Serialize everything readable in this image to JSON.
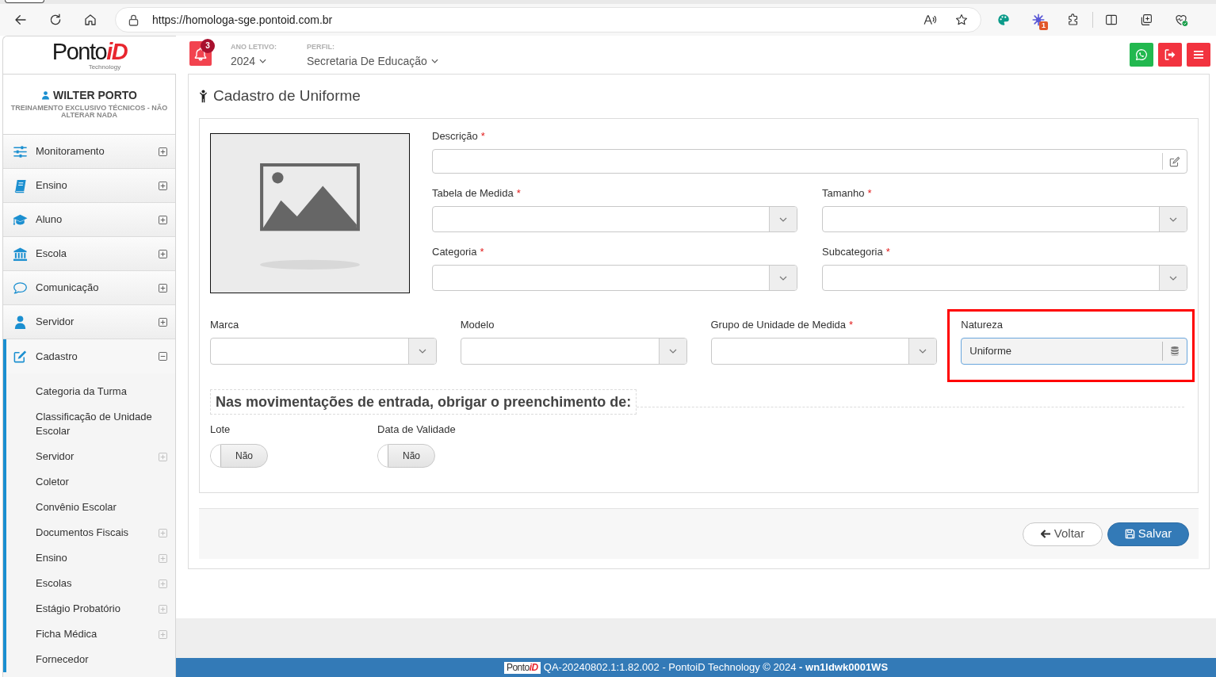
{
  "browser": {
    "url": "https://homologa-sge.pontoid.com.br",
    "extension_badge": "1"
  },
  "header": {
    "logo": {
      "wordmark": "Ponto",
      "accent": "iD",
      "tagline": "Technology"
    },
    "notification_count": "3",
    "selectors": [
      {
        "label": "ANO LETIVO:",
        "value": "2024"
      },
      {
        "label": "PERFIL:",
        "value": "Secretaria De Educação"
      }
    ],
    "actions": [
      {
        "kind": "chat"
      },
      {
        "kind": "logout"
      },
      {
        "kind": "menu"
      }
    ]
  },
  "sidebar": {
    "user": {
      "name": "WILTER PORTO",
      "subtitle": "TREINAMENTO EXCLUSIVO TÉCNICOS - NÃO ALTERAR NADA"
    },
    "items": [
      {
        "label": "Monitoramento",
        "kind": "monitoring",
        "expanded": false
      },
      {
        "label": "Ensino",
        "kind": "teaching",
        "expanded": false
      },
      {
        "label": "Aluno",
        "kind": "student",
        "expanded": false
      },
      {
        "label": "Escola",
        "kind": "school",
        "expanded": false
      },
      {
        "label": "Comunicação",
        "kind": "communication",
        "expanded": false
      },
      {
        "label": "Servidor",
        "kind": "staff",
        "expanded": false
      },
      {
        "label": "Cadastro",
        "kind": "registry",
        "expanded": true,
        "children": [
          {
            "label": "Categoria da Turma",
            "has_children": false
          },
          {
            "label": "Classificação de Unidade Escolar",
            "has_children": false
          },
          {
            "label": "Servidor",
            "has_children": true
          },
          {
            "label": "Coletor",
            "has_children": false
          },
          {
            "label": "Convênio Escolar",
            "has_children": false
          },
          {
            "label": "Documentos Fiscais",
            "has_children": true
          },
          {
            "label": "Ensino",
            "has_children": true
          },
          {
            "label": "Escolas",
            "has_children": true
          },
          {
            "label": "Estágio Probatório",
            "has_children": true
          },
          {
            "label": "Ficha Médica",
            "has_children": true
          },
          {
            "label": "Fornecedor",
            "has_children": false
          }
        ]
      }
    ]
  },
  "page": {
    "title": "Cadastro de Uniforme",
    "upper_rows": [
      [
        {
          "label": "Descrição",
          "required_mark": "*",
          "kind": "text",
          "highlighted": false
        }
      ],
      [
        {
          "label": "Tabela de Medida",
          "required_mark": "*",
          "kind": "select",
          "highlighted": false
        },
        {
          "label": "Tamanho",
          "required_mark": "*",
          "kind": "select",
          "highlighted": false
        }
      ],
      [
        {
          "label": "Categoria",
          "required_mark": "*",
          "kind": "select",
          "highlighted": false
        },
        {
          "label": "Subcategoria",
          "required_mark": "*",
          "kind": "select",
          "highlighted": false
        }
      ]
    ],
    "lower_fields": [
      {
        "label": "Marca",
        "kind": "select",
        "highlighted": false
      },
      {
        "label": "Modelo",
        "kind": "select",
        "highlighted": false
      },
      {
        "label": "Grupo de Unidade de Medida",
        "required_mark": "*",
        "kind": "select",
        "highlighted": false
      },
      {
        "label": "Natureza",
        "kind": "readonly",
        "value": "Uniforme",
        "highlighted": true
      }
    ],
    "section": {
      "title": "Nas movimentações de entrada, obrigar o preenchimento de:",
      "toggles": [
        {
          "label": "Lote",
          "value": "Não",
          "on": false
        },
        {
          "label": "Data de Validade",
          "value": "Não",
          "on": false
        }
      ]
    },
    "buttons": [
      {
        "kind": "back",
        "label": "Voltar"
      },
      {
        "kind": "save",
        "label": "Salvar"
      }
    ]
  },
  "footer": {
    "logo": {
      "wordmark": "Ponto",
      "accent": "iD"
    },
    "text": "QA-20240802.1:1.82.002 - PontoiD Technology © 2024 **- wn1ldwk0001WS**"
  }
}
